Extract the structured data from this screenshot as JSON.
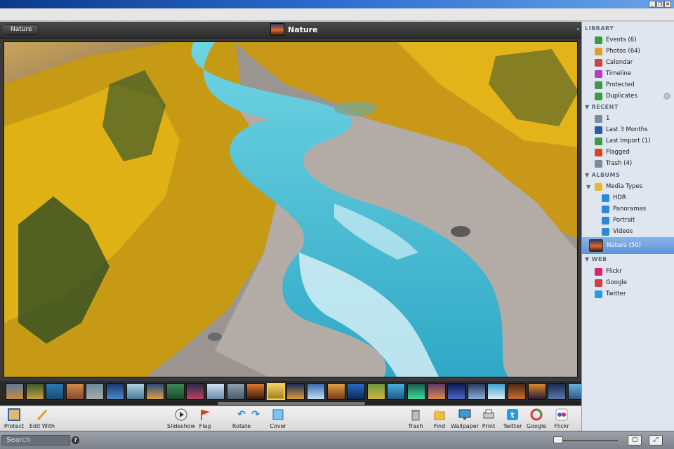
{
  "window": {
    "minimize": "_",
    "restore": "❐",
    "close": "✕"
  },
  "viewer": {
    "back_label": "Nature",
    "album_title": "Nature"
  },
  "toolbar": {
    "left": [
      {
        "label": "Protect",
        "icon": "protect-icon"
      },
      {
        "label": "Edit With",
        "icon": "pencil-icon"
      }
    ],
    "center": [
      {
        "label": "Slideshow",
        "icon": "play-icon"
      },
      {
        "label": "Flag",
        "icon": "flag-icon"
      },
      {
        "label": "Rotate",
        "icon": "rotate-left-icon"
      },
      {
        "label": "",
        "icon": "rotate-right-icon"
      },
      {
        "label": "Cover",
        "icon": "cover-icon"
      }
    ],
    "right": [
      {
        "label": "Trash",
        "icon": "trash-icon"
      },
      {
        "label": "Find",
        "icon": "folder-icon"
      },
      {
        "label": "Wallpaper",
        "icon": "monitor-icon"
      },
      {
        "label": "Print",
        "icon": "printer-icon"
      },
      {
        "label": "Twitter",
        "icon": "twitter-icon"
      },
      {
        "label": "Google",
        "icon": "google-icon"
      },
      {
        "label": "Flickr",
        "icon": "flickr-icon"
      }
    ]
  },
  "sidebar": {
    "library": {
      "heading": "LIBRARY",
      "items": [
        {
          "label": "Events (6)",
          "icon": "events-icon",
          "color": "#3c9a46"
        },
        {
          "label": "Photos (64)",
          "icon": "photos-icon",
          "color": "#e0a020"
        },
        {
          "label": "Calendar",
          "icon": "calendar-icon",
          "color": "#d04040"
        },
        {
          "label": "Timeline",
          "icon": "timeline-icon",
          "color": "#b040c0"
        },
        {
          "label": "Protected",
          "icon": "protected-icon",
          "color": "#3c9a46"
        },
        {
          "label": "Duplicates",
          "icon": "duplicates-icon",
          "color": "#3c9a46"
        }
      ]
    },
    "recent": {
      "heading": "RECENT",
      "items": [
        {
          "label": "1",
          "icon": "edit-icon",
          "color": "#7a8a9a"
        },
        {
          "label": "Last 3 Months",
          "icon": "clock-icon",
          "color": "#2a5aa0"
        },
        {
          "label": "Last Import (1)",
          "icon": "import-icon",
          "color": "#3c9a46"
        },
        {
          "label": "Flagged",
          "icon": "flag-icon",
          "color": "#e04020"
        },
        {
          "label": "Trash (4)",
          "icon": "trash-icon",
          "color": "#7a8a9a"
        }
      ]
    },
    "albums": {
      "heading": "ALBUMS",
      "folder": {
        "label": "Media Types",
        "icon": "folder-icon",
        "color": "#e8b830"
      },
      "items": [
        {
          "label": "HDR",
          "icon": "album-icon",
          "color": "#2a8ad8"
        },
        {
          "label": "Panoramas",
          "icon": "album-icon",
          "color": "#2a8ad8"
        },
        {
          "label": "Portrait",
          "icon": "album-icon",
          "color": "#2a8ad8"
        },
        {
          "label": "Videos",
          "icon": "album-icon",
          "color": "#2a8ad8"
        }
      ],
      "selected": {
        "label": "Nature (50)",
        "icon": "album-thumb-icon"
      }
    },
    "web": {
      "heading": "WEB",
      "items": [
        {
          "label": "Flickr",
          "icon": "flickr-icon",
          "color": "#e0206a"
        },
        {
          "label": "Google",
          "icon": "google-icon",
          "color": "#d04040"
        },
        {
          "label": "Twitter",
          "icon": "twitter-icon",
          "color": "#2a9ae0"
        }
      ]
    }
  },
  "status": {
    "search_placeholder": "Search",
    "help": "?"
  },
  "colors": {
    "accent": "#5f93d6",
    "viewer_bg": "#3a3a3a",
    "sidebar_bg": "#dfe6ef"
  }
}
